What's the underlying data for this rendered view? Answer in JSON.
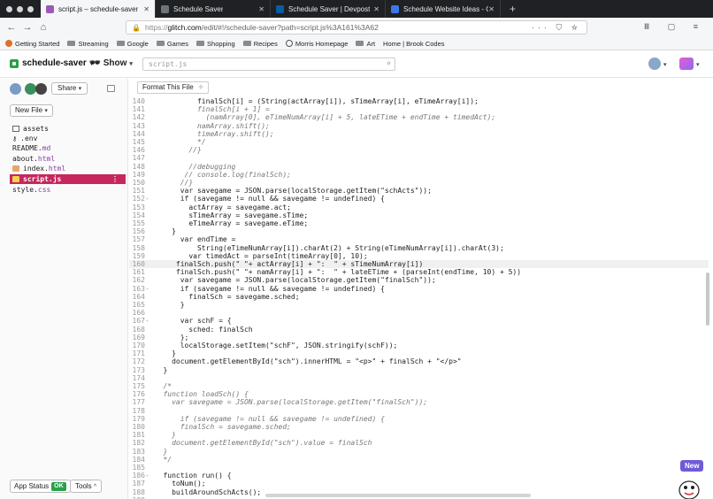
{
  "browser": {
    "tabs": [
      {
        "title": "script.js – schedule-saver",
        "active": true,
        "favicon_color": "#9b59b6"
      },
      {
        "title": "Schedule Saver",
        "active": false,
        "favicon_color": "#6c757d"
      },
      {
        "title": "Schedule Saver | Devpost",
        "active": false,
        "favicon_color": "#0a5ba6"
      },
      {
        "title": "Schedule Website Ideas - Goog",
        "active": false,
        "favicon_color": "#3b78e7"
      }
    ],
    "new_tab_label": "+",
    "url_prefix": "https://",
    "url_domain": "glitch.com",
    "url_path": "/edit/#!/schedule-saver?path=script.js%3A161%3A62",
    "bookmarks": [
      "Getting Started",
      "Streaming",
      "Google",
      "Games",
      "Shopping",
      "Recipes",
      "Morris Homepage",
      "Art",
      "Home | Brook Codes"
    ]
  },
  "app": {
    "project_name": "schedule-saver",
    "show_label": "Show",
    "search_value": "script.js",
    "share_label": "Share",
    "new_file_label": "New File",
    "files": [
      {
        "base": "assets",
        "ext": "",
        "icon": "folder-icon",
        "selected": false
      },
      {
        "base": ".env",
        "ext": "",
        "icon": "key-icon",
        "selected": false
      },
      {
        "base": "README.",
        "ext": "md",
        "icon": "",
        "selected": false
      },
      {
        "base": "about.",
        "ext": "html",
        "icon": "",
        "selected": false
      },
      {
        "base": "index.",
        "ext": "html",
        "icon": "html-icon",
        "selected": false
      },
      {
        "base": "script.",
        "ext": "js",
        "icon": "js-icon",
        "selected": true
      },
      {
        "base": "style.",
        "ext": "css",
        "icon": "",
        "selected": false
      }
    ],
    "app_status_label": "App Status",
    "status_ok": "OK",
    "tools_label": "Tools",
    "format_label": "Format This File",
    "new_badge": "New",
    "accent_color": "#c6285e"
  },
  "code_lines": [
    {
      "n": "140",
      "fold": "",
      "t": "          finalSch[i] = (String(actArray[i]), sTimeArray[i], eTimeArray[i]);",
      "style": ""
    },
    {
      "n": "141",
      "fold": "",
      "t": "          finalSch[i + 1] =",
      "style": "cm"
    },
    {
      "n": "142",
      "fold": "",
      "t": "            (namArray[0], eTimeNumArray[i] + 5, lateETime + endTime + timedAct);",
      "style": "cm"
    },
    {
      "n": "143",
      "fold": "",
      "t": "          namArray.shift();",
      "style": "cm"
    },
    {
      "n": "144",
      "fold": "",
      "t": "          timeArray.shift();",
      "style": "cm"
    },
    {
      "n": "145",
      "fold": "",
      "t": "          */",
      "style": "cm"
    },
    {
      "n": "146",
      "fold": "",
      "t": "        //}",
      "style": "cm"
    },
    {
      "n": "147",
      "fold": "",
      "t": "",
      "style": ""
    },
    {
      "n": "148",
      "fold": "",
      "t": "        //debugging",
      "style": "cm"
    },
    {
      "n": "149",
      "fold": "",
      "t": "       // console.log(finalSch);",
      "style": "cm"
    },
    {
      "n": "150",
      "fold": "",
      "t": "      //}",
      "style": "cm"
    },
    {
      "n": "151",
      "fold": "",
      "t": "      var savegame = JSON.parse(localStorage.getItem(\"schActs\"));",
      "style": ""
    },
    {
      "n": "152",
      "fold": "-",
      "t": "      if (savegame != null && savegame != undefined) {",
      "style": ""
    },
    {
      "n": "153",
      "fold": "",
      "t": "        actArray = savegame.act;",
      "style": ""
    },
    {
      "n": "154",
      "fold": "",
      "t": "        sTimeArray = savegame.sTime;",
      "style": ""
    },
    {
      "n": "155",
      "fold": "",
      "t": "        eTimeArray = savegame.eTime;",
      "style": ""
    },
    {
      "n": "156",
      "fold": "",
      "t": "    }",
      "style": ""
    },
    {
      "n": "157",
      "fold": "",
      "t": "      var endTime =",
      "style": ""
    },
    {
      "n": "158",
      "fold": "",
      "t": "          String(eTimeNumArray[i]).charAt(2) + String(eTimeNumArray[i]).charAt(3);",
      "style": ""
    },
    {
      "n": "159",
      "fold": "",
      "t": "        var timedAct = parseInt(timeArray[0], 10);",
      "style": ""
    },
    {
      "n": "160",
      "fold": "",
      "t": "     finalSch.push(\" \"+ actArray[i] + \":  \" + sTimeNumArray[i])",
      "style": "hl"
    },
    {
      "n": "161",
      "fold": "",
      "t": "     finalSch.push(\" \"+ namArray[i] + \":  \" + lateETime + (parseInt(endTime, 10) + 5))",
      "style": ""
    },
    {
      "n": "162",
      "fold": "",
      "t": "      var savegame = JSON.parse(localStorage.getItem(\"finalSch\"));",
      "style": ""
    },
    {
      "n": "163",
      "fold": "-",
      "t": "      if (savegame != null && savegame != undefined) {",
      "style": ""
    },
    {
      "n": "164",
      "fold": "",
      "t": "        finalSch = savegame.sched;",
      "style": ""
    },
    {
      "n": "165",
      "fold": "",
      "t": "      }",
      "style": ""
    },
    {
      "n": "166",
      "fold": "",
      "t": "",
      "style": ""
    },
    {
      "n": "167",
      "fold": "-",
      "t": "      var schF = {",
      "style": ""
    },
    {
      "n": "168",
      "fold": "",
      "t": "        sched: finalSch",
      "style": ""
    },
    {
      "n": "169",
      "fold": "",
      "t": "      };",
      "style": ""
    },
    {
      "n": "170",
      "fold": "",
      "t": "      localStorage.setItem(\"schF\", JSON.stringify(schF));",
      "style": ""
    },
    {
      "n": "171",
      "fold": "",
      "t": "    }",
      "style": ""
    },
    {
      "n": "172",
      "fold": "",
      "t": "    document.getElementById(\"sch\").innerHTML = \"<p>\" + finalSch + \"</p>\"",
      "style": ""
    },
    {
      "n": "173",
      "fold": "",
      "t": "  }",
      "style": ""
    },
    {
      "n": "174",
      "fold": "",
      "t": "",
      "style": ""
    },
    {
      "n": "175",
      "fold": "",
      "t": "  /*",
      "style": "cm"
    },
    {
      "n": "176",
      "fold": "",
      "t": "  function loadSch() {",
      "style": "cm"
    },
    {
      "n": "177",
      "fold": "",
      "t": "    var savegame = JSON.parse(localStorage.getItem(\"finalSch\"));",
      "style": "cm"
    },
    {
      "n": "178",
      "fold": "",
      "t": "",
      "style": "cm"
    },
    {
      "n": "179",
      "fold": "",
      "t": "      if (savegame != null && savegame != undefined) {",
      "style": "cm"
    },
    {
      "n": "180",
      "fold": "",
      "t": "      finalSch = savegame.sched;",
      "style": "cm"
    },
    {
      "n": "181",
      "fold": "",
      "t": "    }",
      "style": "cm"
    },
    {
      "n": "182",
      "fold": "",
      "t": "    document.getElementById(\"sch\").value = finalSch",
      "style": "cm"
    },
    {
      "n": "183",
      "fold": "",
      "t": "  }",
      "style": "cm"
    },
    {
      "n": "184",
      "fold": "",
      "t": "  */",
      "style": "cm"
    },
    {
      "n": "185",
      "fold": "",
      "t": "",
      "style": ""
    },
    {
      "n": "186",
      "fold": "-",
      "t": "  function run() {",
      "style": ""
    },
    {
      "n": "187",
      "fold": "",
      "t": "    toNum();",
      "style": ""
    },
    {
      "n": "188",
      "fold": "",
      "t": "    buildAroundSchActs();",
      "style": ""
    },
    {
      "n": "189",
      "fold": "",
      "t": "",
      "style": ""
    }
  ]
}
